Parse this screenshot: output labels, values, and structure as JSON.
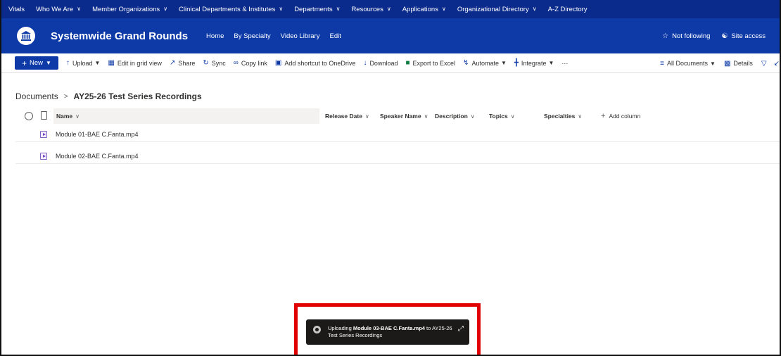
{
  "topnav": {
    "items": [
      {
        "label": "Vitals",
        "dropdown": false
      },
      {
        "label": "Who We Are",
        "dropdown": true
      },
      {
        "label": "Member Organizations",
        "dropdown": true
      },
      {
        "label": "Clinical Departments & Institutes",
        "dropdown": true
      },
      {
        "label": "Departments",
        "dropdown": true
      },
      {
        "label": "Resources",
        "dropdown": true
      },
      {
        "label": "Applications",
        "dropdown": true
      },
      {
        "label": "Organizational Directory",
        "dropdown": true
      },
      {
        "label": "A-Z Directory",
        "dropdown": false
      }
    ]
  },
  "site": {
    "title": "Systemwide Grand Rounds",
    "links": [
      "Home",
      "By Specialty",
      "Video Library",
      "Edit"
    ],
    "not_following": "Not following",
    "site_access": "Site access"
  },
  "commandbar": {
    "new_label": "New",
    "upload": "Upload",
    "edit_grid": "Edit in grid view",
    "share": "Share",
    "sync": "Sync",
    "copy_link": "Copy link",
    "add_shortcut": "Add shortcut to OneDrive",
    "download": "Download",
    "export_excel": "Export to Excel",
    "automate": "Automate",
    "integrate": "Integrate",
    "more": "···",
    "all_documents": "All Documents",
    "details": "Details"
  },
  "breadcrumb": {
    "root": "Documents",
    "separator": ">",
    "current": "AY25-26 Test Series Recordings"
  },
  "columns": {
    "name": "Name",
    "release_date": "Release Date",
    "speaker_name": "Speaker Name",
    "description": "Description",
    "topics": "Topics",
    "specialties": "Specialties",
    "add_column": "Add column"
  },
  "files": [
    {
      "name": "Module 01-BAE C.Fanta.mp4"
    },
    {
      "name": "Module 02-BAE C.Fanta.mp4"
    }
  ],
  "toast": {
    "prefix": "Uploading ",
    "filename": "Module 03-BAE C.Fanta.mp4",
    "suffix": " to AY25-26 Test Series Recordings"
  },
  "colors": {
    "topnav_bg": "#0b2b8c",
    "header_bg": "#0e3aa8",
    "highlight": "#e00000",
    "toast_bg": "#1b1a19"
  }
}
